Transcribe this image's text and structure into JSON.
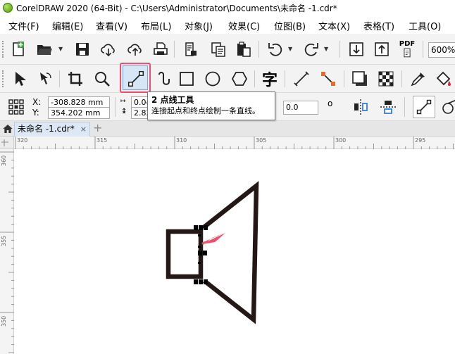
{
  "window": {
    "title": "CorelDRAW 2020 (64-Bit) - C:\\Users\\Administrator\\Documents\\未命名 -1.cdr*"
  },
  "menu": {
    "items": [
      "文件(F)",
      "编辑(E)",
      "查看(V)",
      "布局(L)",
      "对象(J)",
      "效果(C)",
      "位图(B)",
      "文本(X)",
      "表格(T)",
      "工具(O)"
    ]
  },
  "standard_toolbar": {
    "icons": [
      "new-document-icon",
      "open-folder-icon",
      "save-icon",
      "cloud-download-icon",
      "cloud-upload-icon",
      "print-icon",
      "document-settings-icon",
      "copy-icon",
      "paste-icon",
      "undo-icon",
      "redo-icon",
      "import-icon",
      "export-icon",
      "pdf-icon"
    ],
    "pdf_label": "PDF",
    "zoom_value": "600%"
  },
  "toolbox": {
    "active_tool": "2点线工具",
    "icons": [
      "pick-tool-icon",
      "shape-tool-icon",
      "crop-tool-icon",
      "zoom-tool-icon",
      "two-point-line-icon",
      "artistic-media-icon",
      "rectangle-icon",
      "ellipse-icon",
      "polygon-icon",
      "text-tool-icon",
      "parallel-dimension-icon",
      "connector-icon",
      "drop-shadow-icon",
      "transparency-icon",
      "eyedropper-icon",
      "fill-icon"
    ],
    "text_tool_glyph": "字"
  },
  "property_bar": {
    "x_label": "X:",
    "y_label": "Y:",
    "x_value": "-308.828 mm",
    "y_value": "354.202 mm",
    "w_value": "0.04",
    "h_value": "2.82",
    "angle_value": "0.0",
    "degree_symbol": "o"
  },
  "tooltip": {
    "title": "2 点线工具",
    "description": "连接起点和终点绘制一条直线。"
  },
  "tabs": {
    "doc_title": "未命名 -1.cdr*",
    "close_glyph": "×",
    "add_glyph": "+"
  },
  "rulers": {
    "horizontal": [
      "320",
      "315",
      "310",
      "305",
      "300",
      "295"
    ],
    "vertical": [
      "360",
      "355",
      "350"
    ]
  },
  "colors": {
    "accent": "#ef4f6a",
    "selection_handle": "#000000",
    "shape_stroke": "#231815"
  }
}
